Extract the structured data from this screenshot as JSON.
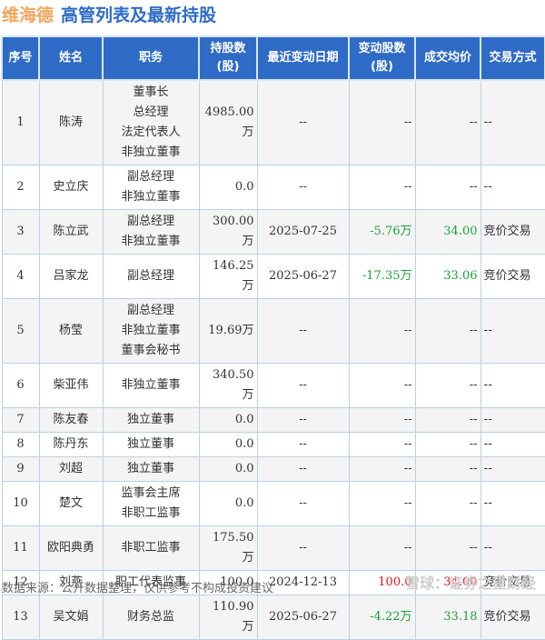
{
  "title": {
    "company": "维海德",
    "heading": "高管列表及最新持股"
  },
  "columns": [
    "序号",
    "姓名",
    "职务",
    "持股数\n(股)",
    "最近变动日期",
    "变动股数\n(股)",
    "成交均价",
    "交易方式"
  ],
  "rows": [
    {
      "no": "1",
      "name": "陈涛",
      "roles": [
        "董事长",
        "总经理",
        "法定代表人",
        "非独立董事"
      ],
      "shares": "4985.00万",
      "date": "--",
      "change": "--",
      "price": "--",
      "method": "--",
      "color": ""
    },
    {
      "no": "2",
      "name": "史立庆",
      "roles": [
        "副总经理",
        "非独立董事"
      ],
      "shares": "0.0",
      "date": "--",
      "change": "--",
      "price": "--",
      "method": "--",
      "color": ""
    },
    {
      "no": "3",
      "name": "陈立武",
      "roles": [
        "副总经理",
        "非独立董事"
      ],
      "shares": "300.00万",
      "date": "2025-07-25",
      "change": "-5.76万",
      "price": "34.00",
      "method": "竞价交易",
      "color": "green"
    },
    {
      "no": "4",
      "name": "吕家龙",
      "roles": [
        "副总经理"
      ],
      "shares": "146.25万",
      "date": "2025-06-27",
      "change": "-17.35万",
      "price": "33.06",
      "method": "竞价交易",
      "color": "green"
    },
    {
      "no": "5",
      "name": "杨莹",
      "roles": [
        "副总经理",
        "非独立董事",
        "董事会秘书"
      ],
      "shares": "19.69万",
      "date": "--",
      "change": "--",
      "price": "--",
      "method": "--",
      "color": ""
    },
    {
      "no": "6",
      "name": "柴亚伟",
      "roles": [
        "非独立董事"
      ],
      "shares": "340.50万",
      "date": "--",
      "change": "--",
      "price": "--",
      "method": "--",
      "color": ""
    },
    {
      "no": "7",
      "name": "陈友春",
      "roles": [
        "独立董事"
      ],
      "shares": "0.0",
      "date": "--",
      "change": "--",
      "price": "--",
      "method": "--",
      "color": ""
    },
    {
      "no": "8",
      "name": "陈丹东",
      "roles": [
        "独立董事"
      ],
      "shares": "0.0",
      "date": "--",
      "change": "--",
      "price": "--",
      "method": "--",
      "color": ""
    },
    {
      "no": "9",
      "name": "刘超",
      "roles": [
        "独立董事"
      ],
      "shares": "0.0",
      "date": "--",
      "change": "--",
      "price": "--",
      "method": "--",
      "color": ""
    },
    {
      "no": "10",
      "name": "楚文",
      "roles": [
        "监事会主席",
        "非职工监事"
      ],
      "shares": "0.0",
      "date": "--",
      "change": "--",
      "price": "--",
      "method": "--",
      "color": ""
    },
    {
      "no": "11",
      "name": "欧阳典勇",
      "roles": [
        "非职工监事"
      ],
      "shares": "175.50万",
      "date": "--",
      "change": "--",
      "price": "--",
      "method": "--",
      "color": ""
    },
    {
      "no": "12",
      "name": "刘燕",
      "roles": [
        "职工代表监事"
      ],
      "shares": "100.0",
      "date": "2024-12-13",
      "change": "100.0",
      "price": "34.00",
      "method": "竞价交易",
      "color": "red"
    },
    {
      "no": "13",
      "name": "吴文娟",
      "roles": [
        "财务总监"
      ],
      "shares": "110.90万",
      "date": "2025-06-27",
      "change": "-4.22万",
      "price": "33.18",
      "method": "竞价交易",
      "color": "green"
    }
  ],
  "footer": {
    "source": "数据来源：公开数据整理，仅供参考不构成投资建议",
    "watermark": "雪球：证券之星财经"
  }
}
